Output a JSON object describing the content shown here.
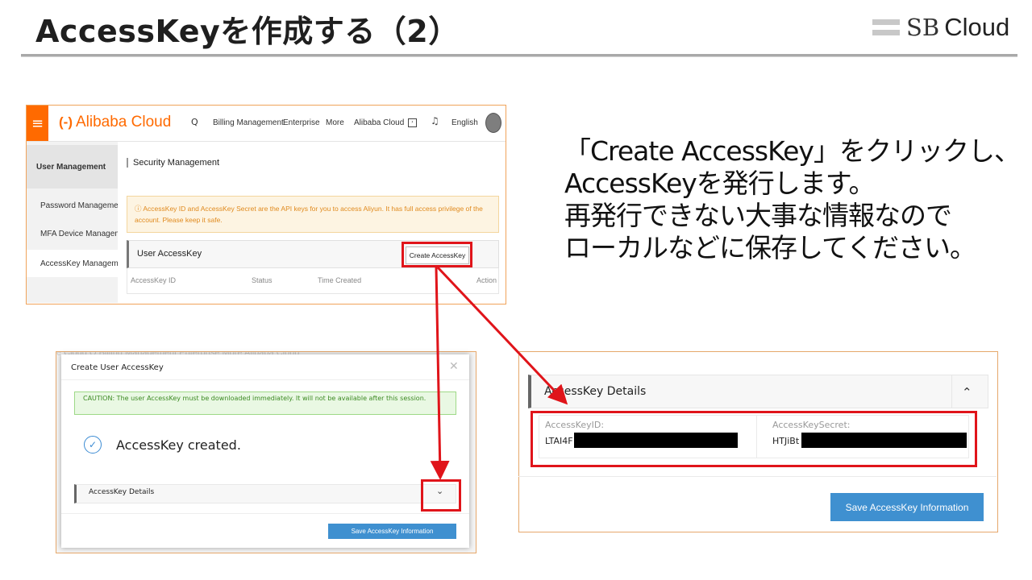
{
  "slide": {
    "title": "AccessKeyを作成する（2）",
    "brand_sb": "SB",
    "brand_cloud": "Cloud"
  },
  "description": {
    "lines": [
      "「Create AccessKey」をクリックし、",
      "AccessKeyを発行します。",
      "再発行できない大事な情報なので",
      "ローカルなどに保存してください。"
    ]
  },
  "console": {
    "logo": "Alibaba Cloud",
    "logo_mark": "(-)",
    "nav": {
      "billing": "Billing Management",
      "enterprise": "Enterprise",
      "more": "More",
      "alibaba_cloud": "Alibaba Cloud",
      "language": "English"
    },
    "sidebar": {
      "user_management": "User Management",
      "password": "Password Management",
      "mfa": "MFA Device Managem...",
      "accesskey": "AccessKey Management"
    },
    "security_title": "Security Management",
    "notice": "ⓘ AccessKey ID and AccessKey Secret are the API keys for you to access Aliyun. It has full access privilege of the account. Please keep it safe.",
    "user_accesskey": "User AccessKey",
    "create_button": "Create AccessKey",
    "columns": {
      "id": "AccessKey ID",
      "status": "Status",
      "time": "Time Created",
      "action": "Action"
    }
  },
  "dialog": {
    "behind_text": "e Cloud      Q    Billing Management     Enterprise     More     Alibaba Cloud",
    "title": "Create User AccessKey",
    "close": "✕",
    "caution": "CAUTION: The user AccessKey must be downloaded immediately. It will not be available after this session.",
    "created": "AccessKey created.",
    "details_label": "AccessKey Details",
    "save_button": "Save AccessKey Information"
  },
  "details": {
    "title": "AccessKey Details",
    "id_label": "AccessKeyID:",
    "id_value": "LTAI4F",
    "secret_label": "AccessKeySecret:",
    "secret_value": "HTJiBt",
    "save_button": "Save AccessKey Information"
  },
  "colors": {
    "alibaba_orange": "#ff6a00",
    "highlight_red": "#e0141a",
    "button_blue": "#3f90d0"
  }
}
